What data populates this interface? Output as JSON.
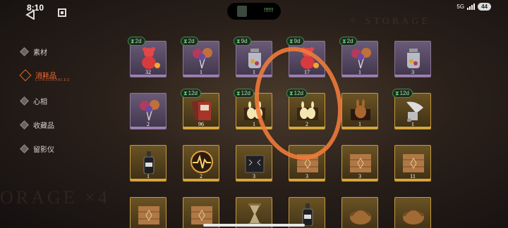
{
  "status_bar": {
    "time": "8:10",
    "signal": "5G",
    "battery": "44",
    "island_dots": "!!!!!!"
  },
  "background": {
    "top_word": "✧ STORAGE",
    "bottom_word": "ORAGE ×4"
  },
  "sidebar": {
    "items": [
      {
        "label": "素材",
        "active": false
      },
      {
        "label": "消耗品",
        "active": true,
        "sub": "CONSUMABLES"
      },
      {
        "label": "心相",
        "active": false
      },
      {
        "label": "收藏品",
        "active": false
      },
      {
        "label": "留影仪",
        "active": false
      }
    ]
  },
  "inventory": {
    "rows": [
      [
        {
          "icon": "gummy-bear-icon",
          "rarity": "purple",
          "qty": "32",
          "badge": "2d"
        },
        {
          "icon": "lollipop-bundle-icon",
          "rarity": "purple",
          "qty": "1",
          "badge": "2d"
        },
        {
          "icon": "candy-jar-icon",
          "rarity": "purple",
          "qty": "1",
          "badge": "9d"
        },
        {
          "icon": "gummy-bear-icon",
          "rarity": "purple",
          "qty": "17",
          "badge": "9d"
        },
        {
          "icon": "lollipop-bundle-icon",
          "rarity": "purple",
          "qty": "1",
          "badge": "2d"
        },
        {
          "icon": "candy-jar-icon",
          "rarity": "purple",
          "qty": "3",
          "badge": ""
        }
      ],
      [
        {
          "icon": "lollipop-bundle-icon",
          "rarity": "purple",
          "qty": "2",
          "badge": ""
        },
        {
          "icon": "card-pack-icon",
          "rarity": "gold",
          "qty": "96",
          "badge": "12d"
        },
        {
          "icon": "bunny-box-icon",
          "rarity": "gold",
          "qty": "1",
          "badge": "12d"
        },
        {
          "icon": "bunny-box-icon",
          "rarity": "gold",
          "qty": "2",
          "badge": "12d"
        },
        {
          "icon": "bunny-chocolate-icon",
          "rarity": "gold",
          "qty": "1",
          "badge": ""
        },
        {
          "icon": "gramophone-icon",
          "rarity": "gold",
          "qty": "1",
          "badge": "12d"
        }
      ],
      [
        {
          "icon": "bottle-icon",
          "rarity": "gold",
          "qty": "1",
          "badge": ""
        },
        {
          "icon": "heartbeat-orb-icon",
          "rarity": "gold",
          "qty": "2",
          "badge": ""
        },
        {
          "icon": "music-box-icon",
          "rarity": "gold",
          "qty": "3",
          "badge": ""
        },
        {
          "icon": "wooden-crate-icon",
          "rarity": "gold",
          "qty": "3",
          "badge": ""
        },
        {
          "icon": "wooden-crate-icon",
          "rarity": "gold",
          "qty": "3",
          "badge": ""
        },
        {
          "icon": "wooden-crate-icon",
          "rarity": "gold",
          "qty": "11",
          "badge": ""
        }
      ],
      [
        {
          "icon": "wooden-crate-icon",
          "rarity": "gold",
          "qty": "",
          "badge": ""
        },
        {
          "icon": "wooden-crate-icon",
          "rarity": "gold",
          "qty": "",
          "badge": ""
        },
        {
          "icon": "hourglass-icon",
          "rarity": "gold",
          "qty": "",
          "badge": ""
        },
        {
          "icon": "bottle-icon",
          "rarity": "gold",
          "qty": "",
          "badge": ""
        },
        {
          "icon": "basket-icon",
          "rarity": "gold",
          "qty": "",
          "badge": ""
        },
        {
          "icon": "basket-icon",
          "rarity": "gold",
          "qty": "",
          "badge": ""
        }
      ]
    ]
  },
  "colors": {
    "accent": "#ff6a2e",
    "badge_green": "#5fcf74",
    "gold": "#c79a3c",
    "purple": "#8a7696"
  }
}
